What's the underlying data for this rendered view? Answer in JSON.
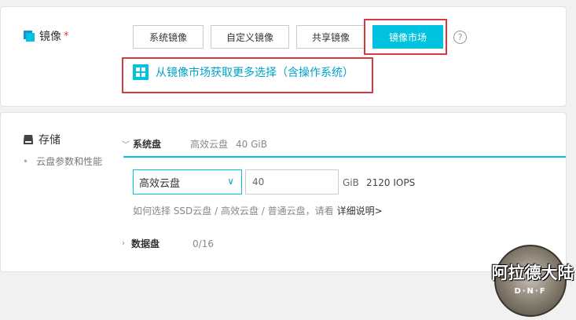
{
  "image_section": {
    "title": "镜像",
    "required_mark": "*",
    "tabs": [
      {
        "label": "系统镜像",
        "active": false
      },
      {
        "label": "自定义镜像",
        "active": false
      },
      {
        "label": "共享镜像",
        "active": false
      },
      {
        "label": "镜像市场",
        "active": true
      }
    ],
    "help_glyph": "?",
    "market_link": "从镜像市场获取更多选择（含操作系统）",
    "link_icon": "grid-icon"
  },
  "storage_section": {
    "title": "存储",
    "bullet": "•",
    "subtitle": "云盘参数和性能",
    "system_disk": {
      "label": "系统盘",
      "summary_type": "高效云盘",
      "summary_size": "40 GiB",
      "select_value": "高效云盘",
      "size_value": "40",
      "unit": "GiB",
      "iops": "2120 IOPS",
      "help_text": "如何选择 SSD云盘 / 高效云盘 / 普通云盘，请看",
      "help_link": "详细说明>"
    },
    "data_disk": {
      "label": "数据盘",
      "count": "0/16"
    }
  },
  "watermark": {
    "text": "阿拉德大陆",
    "sub": "D·N·F"
  },
  "colors": {
    "accent": "#00c1de",
    "link": "#00a2ca",
    "annotation_red": "#d9363e",
    "required": "#e53935"
  }
}
